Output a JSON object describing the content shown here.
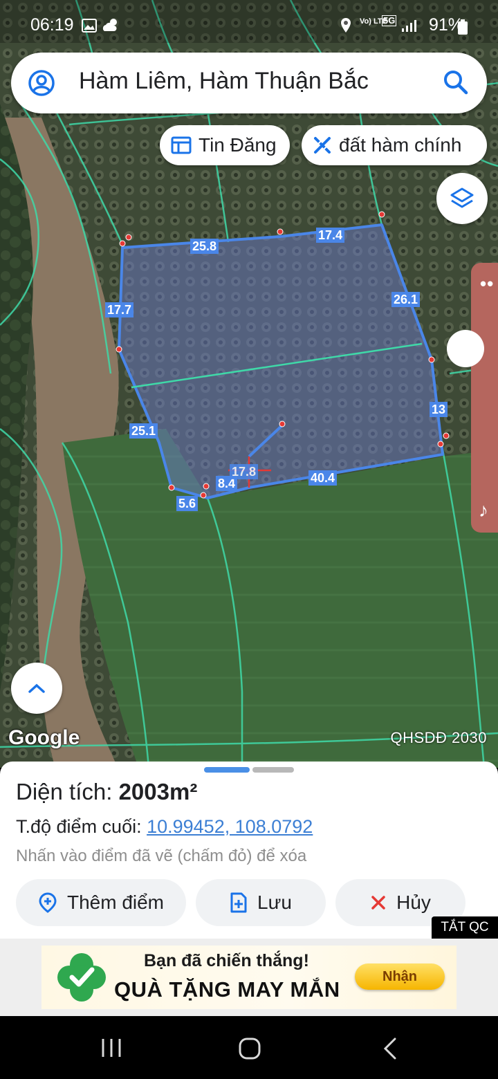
{
  "status_bar": {
    "time": "06:19",
    "battery": "91%",
    "network_label": "5G",
    "volte_label": "Vo) LTE",
    "icons": [
      "gallery-icon",
      "weather-cloud-sun-icon",
      "location-icon",
      "volte-icon",
      "5g-icon",
      "signal-icon",
      "battery-icon"
    ]
  },
  "search": {
    "text": "Hàm Liêm, Hàm Thuận Bắc"
  },
  "chips": {
    "listings": "Tin Đăng",
    "land": "đất  hàm chính"
  },
  "map": {
    "provider": "Google",
    "overlay_name": "QHSDĐ 2030",
    "measurements": [
      "25.8",
      "17.4",
      "26.1",
      "17.7",
      "13",
      "25.1",
      "8.4",
      "40.4",
      "5.6",
      "17.8"
    ],
    "polygon_color": "#4a86e8",
    "parcel_line_color": "#3fd9a8",
    "marker_color": "#e53935"
  },
  "sheet": {
    "area_label": "Diện tích: ",
    "area_value": "2003m²",
    "coord_label": "T.độ điểm cuối: ",
    "coord_value": "10.99452, 108.0792",
    "hint": "Nhấn vào điểm đã vẽ (chấm đỏ) để xóa",
    "add_point": "Thêm điểm",
    "save": "Lưu",
    "cancel": "Hủy",
    "hide_ads": "TẮT QC"
  },
  "ad": {
    "line1": "Bạn đã chiến thắng!",
    "line2": "QUÀ TẶNG MAY MẮN",
    "claim": "Nhận"
  }
}
